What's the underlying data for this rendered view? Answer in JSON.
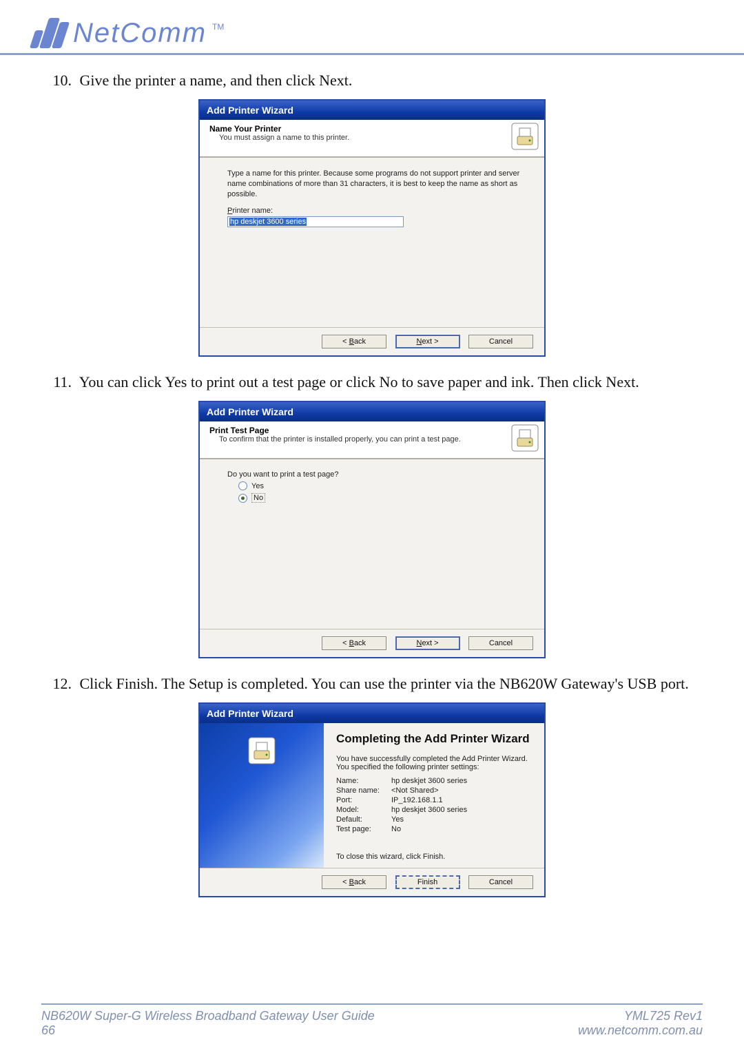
{
  "brand": {
    "name": "NetComm",
    "tm": "TM"
  },
  "steps": [
    {
      "num": "10.",
      "text": "Give the printer a name, and then click Next."
    },
    {
      "num": "11.",
      "text": "You can click Yes to print out a test page or click No to save paper and ink.  Then click Next."
    },
    {
      "num": "12.",
      "text": "Click Finish. The Setup is completed. You can use the printer via the NB620W Gateway's USB port."
    }
  ],
  "wizard1": {
    "title": "Add Printer Wizard",
    "heading": "Name Your Printer",
    "sub": "You must assign a name to this printer.",
    "hint": "Type a name for this printer. Because some programs do not support printer and server name combinations of more than 31 characters, it is best to keep the name as short as possible.",
    "label_pre": "P",
    "label_rest": "rinter name:",
    "value": "hp deskjet 3600 series",
    "back": "< ",
    "back_u": "B",
    "back_rest": "ack",
    "next_u": "N",
    "next_rest": "ext >",
    "cancel": "Cancel"
  },
  "wizard2": {
    "title": "Add Printer Wizard",
    "heading": "Print Test Page",
    "sub": "To confirm that the printer is installed properly, you can print a test page.",
    "question": "Do you want to print a test page?",
    "yes_u": "Y",
    "yes_rest": "es",
    "no_u": "N",
    "no_rest": "o",
    "back": "< ",
    "back_u": "B",
    "back_rest": "ack",
    "next_u": "N",
    "next_rest": "ext >",
    "cancel": "Cancel"
  },
  "wizard3": {
    "title": "Add Printer Wizard",
    "heading": "Completing the Add Printer Wizard",
    "desc": "You have successfully completed the Add Printer Wizard. You specified the following printer settings:",
    "rows": [
      {
        "k": "Name:",
        "v": "hp deskjet 3600 series"
      },
      {
        "k": "Share name:",
        "v": "<Not Shared>"
      },
      {
        "k": "Port:",
        "v": "IP_192.168.1.1"
      },
      {
        "k": "Model:",
        "v": "hp deskjet 3600 series"
      },
      {
        "k": "Default:",
        "v": "Yes"
      },
      {
        "k": "Test page:",
        "v": "No"
      }
    ],
    "closing": "To close this wizard, click Finish.",
    "back": "< ",
    "back_u": "B",
    "back_rest": "ack",
    "finish": "Finish",
    "cancel": "Cancel"
  },
  "footer": {
    "left1": "NB620W Super-G Wireless Broadband  Gateway User Guide",
    "left2": "66",
    "right1": "YML725 Rev1",
    "right2": "www.netcomm.com.au"
  }
}
